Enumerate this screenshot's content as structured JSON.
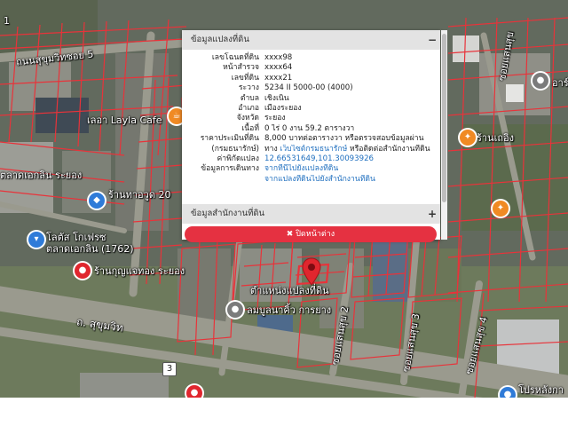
{
  "colors": {
    "parcel_outline": "#e8333a",
    "road": "#9a9a8e",
    "panel_header": "#e3e3e3",
    "close_button": "#e53141",
    "link": "#1f6fbf",
    "pin": "#e0262e"
  },
  "panel": {
    "land_info_header": "ข้อมูลแปลงที่ดิน",
    "land_info_toggle": "−",
    "land_office_header": "ข้อมูลสำนักงานที่ดิน",
    "land_office_toggle": "+",
    "close_label": "ปิดหน้าต่าง",
    "close_icon": "close-icon",
    "fields": {
      "parcel_no": {
        "label": "เลขโฉนดที่ดิน",
        "value": "xxxx98"
      },
      "survey_page": {
        "label": "หน้าสำรวจ",
        "value": "xxxx64"
      },
      "land_no": {
        "label": "เลขที่ดิน",
        "value": "xxxx21"
      },
      "sheet": {
        "label": "ระวาง",
        "value": "5234 II 5000-00 (4000)"
      },
      "subdistrict": {
        "label": "ตำบล",
        "value": "เชิงเนิน"
      },
      "district": {
        "label": "อำเภอ",
        "value": "เมืองระยอง"
      },
      "province": {
        "label": "จังหวัด",
        "value": "ระยอง"
      },
      "area": {
        "label": "เนื้อที่",
        "value": "0 ไร่ 0 งาน 59.2 ตารางวา"
      },
      "appraisal": {
        "label": "ราคาประเมินที่ดิน",
        "value": "8,000 บาทต่อตารางวา หรือตรวจสอบข้อมูลผ่าน"
      },
      "appraisal_source": {
        "label": "(กรมธนารักษ์)",
        "value_prefix": "ทาง ",
        "link_text": "เว็บไซต์กรมธนารักษ์",
        "value_suffix": " หรือติดต่อสำนักงานที่ดิน"
      },
      "coordinates": {
        "label": "ค่าพิกัดแปลง",
        "value": "12.66531649,101.30093926"
      },
      "directions": {
        "label": "ข้อมูลการเดินทาง",
        "link1": "จากที่นี่ไปยังแปลงที่ดิน",
        "link2": "จากแปลงที่ดินไปยังสำนักงานที่ดิน"
      }
    }
  },
  "map": {
    "labels": {
      "road_top_left": "ถนนสุขุมวิทซอย 5",
      "layla_cafe": "เลอา Layla Cafe",
      "market_rayong": "ตลาดเอกลิน ระยอง",
      "shop_20": "ร้านทาอวูด 20",
      "lotus": "โลตัส โกเฟรซ",
      "lotus_sub": "ตลาดเอกลิน (1762)",
      "rayong_gold": "ร้านกุญแจทอง ระยอง",
      "sukhumvit": "ถ. สุขุมวิท",
      "route_3": "3",
      "parcel_position": "ตำแหน่งแปลงที่ดิน",
      "local_shop": "ลมบูลนาคิ้ว การยาง",
      "soi_saen_sook_2": "ซอยแสนสุข 2",
      "soi_saen_sook_3": "ซอยแสนสุข 3",
      "soi_saen_sook_4": "ซอยแสนสุข 4",
      "soi_saen_sook_top": "ซอยแสนสุข",
      "shop_right": "ร้านเถอิง",
      "top_left_num": "1",
      "bottom_right": "โปรหลังกา",
      "right_edge": "อาร์"
    },
    "icons": {
      "cafe": "coffee-icon",
      "shopping_a": "shopping-bag-icon",
      "shopping_b": "cart-icon",
      "pin_left": "location-icon",
      "pin_center": "location-pin-icon",
      "food_right": "restaurant-icon"
    }
  }
}
